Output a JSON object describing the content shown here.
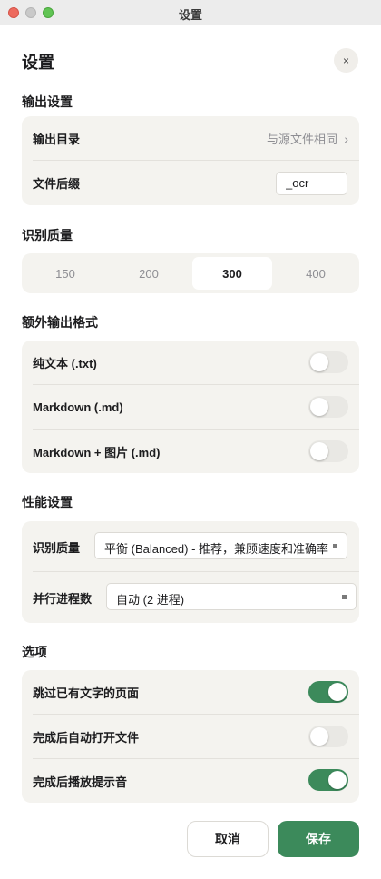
{
  "window": {
    "title": "设置"
  },
  "page": {
    "title": "设置",
    "close_label": "×"
  },
  "output": {
    "section_title": "输出设置",
    "dir_label": "输出目录",
    "dir_value": "与源文件相同",
    "dir_chevron": "›",
    "suffix_label": "文件后缀",
    "suffix_value": "_ocr"
  },
  "quality": {
    "section_title": "识别质量",
    "options": [
      "150",
      "200",
      "300",
      "400"
    ],
    "selected": "300"
  },
  "formats": {
    "section_title": "额外输出格式",
    "items": [
      {
        "label": "纯文本 (.txt)",
        "on": false
      },
      {
        "label": "Markdown (.md)",
        "on": false
      },
      {
        "label": "Markdown + 图片 (.md)",
        "on": false
      }
    ]
  },
  "performance": {
    "section_title": "性能设置",
    "quality_label": "识别质量",
    "quality_value": "平衡 (Balanced) - 推荐，兼顾速度和准确率",
    "workers_label": "并行进程数",
    "workers_value": "自动 (2 进程)"
  },
  "options": {
    "section_title": "选项",
    "items": [
      {
        "label": "跳过已有文字的页面",
        "on": true
      },
      {
        "label": "完成后自动打开文件",
        "on": false
      },
      {
        "label": "完成后播放提示音",
        "on": true
      }
    ]
  },
  "actions": {
    "cancel": "取消",
    "save": "保存"
  },
  "colors": {
    "accent": "#3c8a5b",
    "card": "#f4f3ef"
  }
}
